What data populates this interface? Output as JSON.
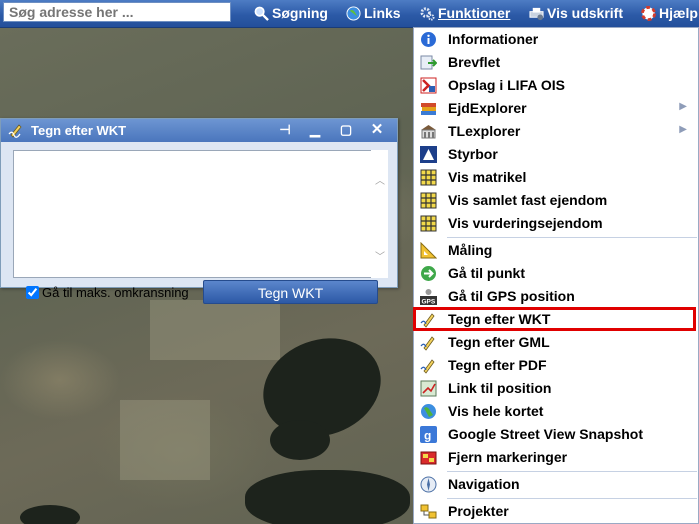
{
  "search": {
    "placeholder": "Søg adresse her ..."
  },
  "toolbar": {
    "items": [
      {
        "label": "Søgning",
        "icon": "search-icon"
      },
      {
        "label": "Links",
        "icon": "globe-icon"
      },
      {
        "label": "Funktioner",
        "icon": "gear-icon"
      },
      {
        "label": "Vis udskrift",
        "icon": "print-icon"
      },
      {
        "label": "Hjælp",
        "icon": "help-icon"
      }
    ]
  },
  "dialog": {
    "title": "Tegn efter WKT",
    "checkbox_label": "Gå til maks. omkransning",
    "checkbox_checked": true,
    "button_label": "Tegn WKT"
  },
  "menu": {
    "items": [
      {
        "label": "Informationer",
        "icon": "info-icon"
      },
      {
        "label": "Brevflet",
        "icon": "mail-merge-icon"
      },
      {
        "label": "Opslag i LIFA OIS",
        "icon": "lifa-ois-icon"
      },
      {
        "label": "EjdExplorer",
        "icon": "books-icon",
        "submenu": true
      },
      {
        "label": "TLexplorer",
        "icon": "building-icon",
        "submenu": true
      },
      {
        "label": "Styrbor",
        "icon": "lifa-logo-icon"
      },
      {
        "label": "Vis matrikel",
        "icon": "grid-map-icon"
      },
      {
        "label": "Vis samlet fast ejendom",
        "icon": "grid-map-icon"
      },
      {
        "label": "Vis vurderingsejendom",
        "icon": "grid-map-icon"
      },
      {
        "label": "Måling",
        "icon": "ruler-icon"
      },
      {
        "label": "Gå til punkt",
        "icon": "goto-arrow-icon"
      },
      {
        "label": "Gå til GPS position",
        "icon": "gps-icon"
      },
      {
        "label": "Tegn efter WKT",
        "icon": "pencil-icon"
      },
      {
        "label": "Tegn efter GML",
        "icon": "pencil-icon"
      },
      {
        "label": "Tegn efter PDF",
        "icon": "pencil-icon"
      },
      {
        "label": "Link til position",
        "icon": "link-position-icon"
      },
      {
        "label": "Vis hele kortet",
        "icon": "globe-icon"
      },
      {
        "label": "Google Street View Snapshot",
        "icon": "google-icon"
      },
      {
        "label": "Fjern markeringer",
        "icon": "clear-markings-icon"
      },
      {
        "label": "Navigation",
        "icon": "compass-icon"
      },
      {
        "label": "Projekter",
        "icon": "projects-icon"
      }
    ]
  },
  "colors": {
    "toolbar": "#2c5aa7",
    "highlight": "#e00000",
    "dialog_bg": "#dde6f3"
  }
}
